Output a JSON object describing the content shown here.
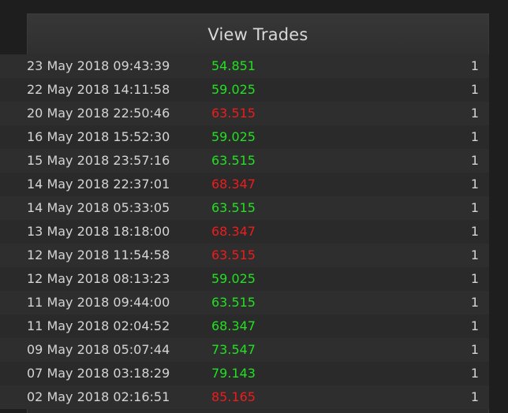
{
  "panel": {
    "title": "View Trades"
  },
  "colors": {
    "up": "#22e022",
    "down": "#ee1c1c"
  },
  "trades": [
    {
      "date": "23 May 2018 09:43:39",
      "price": "54.851",
      "direction": "up",
      "qty": "1"
    },
    {
      "date": "22 May 2018 14:11:58",
      "price": "59.025",
      "direction": "up",
      "qty": "1"
    },
    {
      "date": "20 May 2018 22:50:46",
      "price": "63.515",
      "direction": "down",
      "qty": "1"
    },
    {
      "date": "16 May 2018 15:52:30",
      "price": "59.025",
      "direction": "up",
      "qty": "1"
    },
    {
      "date": "15 May 2018 23:57:16",
      "price": "63.515",
      "direction": "up",
      "qty": "1"
    },
    {
      "date": "14 May 2018 22:37:01",
      "price": "68.347",
      "direction": "down",
      "qty": "1"
    },
    {
      "date": "14 May 2018 05:33:05",
      "price": "63.515",
      "direction": "up",
      "qty": "1"
    },
    {
      "date": "13 May 2018 18:18:00",
      "price": "68.347",
      "direction": "down",
      "qty": "1"
    },
    {
      "date": "12 May 2018 11:54:58",
      "price": "63.515",
      "direction": "down",
      "qty": "1"
    },
    {
      "date": "12 May 2018 08:13:23",
      "price": "59.025",
      "direction": "up",
      "qty": "1"
    },
    {
      "date": "11 May 2018 09:44:00",
      "price": "63.515",
      "direction": "up",
      "qty": "1"
    },
    {
      "date": "11 May 2018 02:04:52",
      "price": "68.347",
      "direction": "up",
      "qty": "1"
    },
    {
      "date": "09 May 2018 05:07:44",
      "price": "73.547",
      "direction": "up",
      "qty": "1"
    },
    {
      "date": "07 May 2018 03:18:29",
      "price": "79.143",
      "direction": "up",
      "qty": "1"
    },
    {
      "date": "02 May 2018 02:16:51",
      "price": "85.165",
      "direction": "down",
      "qty": "1"
    }
  ]
}
